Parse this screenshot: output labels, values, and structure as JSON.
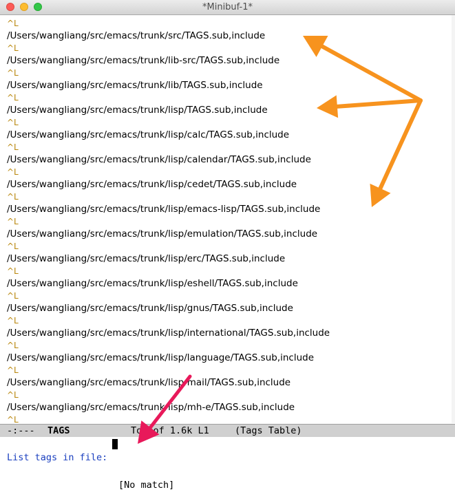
{
  "window": {
    "title": "*Minibuf-1*"
  },
  "buffer": {
    "formfeed": "^L",
    "paths": [
      "/Users/wangliang/src/emacs/trunk/src/TAGS.sub,include",
      "/Users/wangliang/src/emacs/trunk/lib-src/TAGS.sub,include",
      "/Users/wangliang/src/emacs/trunk/lib/TAGS.sub,include",
      "/Users/wangliang/src/emacs/trunk/lisp/TAGS.sub,include",
      "/Users/wangliang/src/emacs/trunk/lisp/calc/TAGS.sub,include",
      "/Users/wangliang/src/emacs/trunk/lisp/calendar/TAGS.sub,include",
      "/Users/wangliang/src/emacs/trunk/lisp/cedet/TAGS.sub,include",
      "/Users/wangliang/src/emacs/trunk/lisp/emacs-lisp/TAGS.sub,include",
      "/Users/wangliang/src/emacs/trunk/lisp/emulation/TAGS.sub,include",
      "/Users/wangliang/src/emacs/trunk/lisp/erc/TAGS.sub,include",
      "/Users/wangliang/src/emacs/trunk/lisp/eshell/TAGS.sub,include",
      "/Users/wangliang/src/emacs/trunk/lisp/gnus/TAGS.sub,include",
      "/Users/wangliang/src/emacs/trunk/lisp/international/TAGS.sub,include",
      "/Users/wangliang/src/emacs/trunk/lisp/language/TAGS.sub,include",
      "/Users/wangliang/src/emacs/trunk/lisp/mail/TAGS.sub,include",
      "/Users/wangliang/src/emacs/trunk/lisp/mh-e/TAGS.sub,include"
    ]
  },
  "modeline": {
    "status": "-:---",
    "buffer_name": "TAGS",
    "position": "Top of 1.6k L1",
    "mode": "(Tags Table)"
  },
  "minibuffer": {
    "prompt": "List tags in file:",
    "message": "[No match]"
  },
  "annotations": {
    "arrow_color": "#f7931e",
    "pointer_color": "#e8195a"
  }
}
